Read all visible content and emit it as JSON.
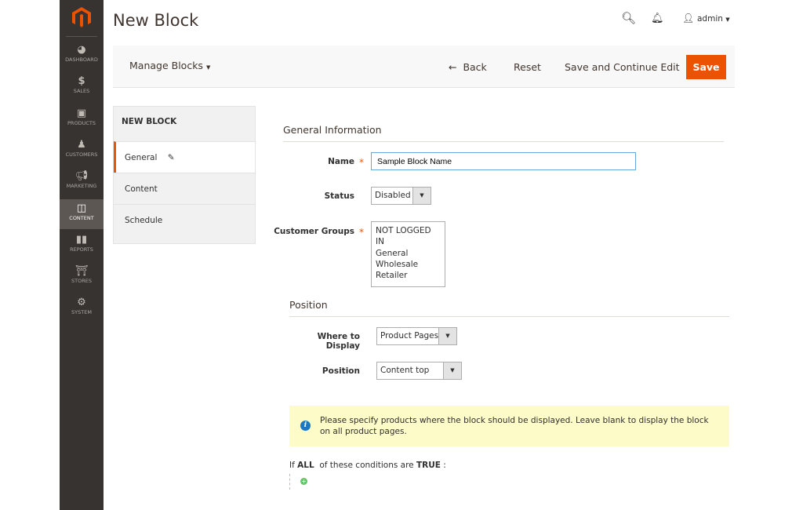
{
  "nav": {
    "items": [
      {
        "label": "DASHBOARD",
        "icon": "gauge-icon"
      },
      {
        "label": "SALES",
        "icon": "dollar-icon"
      },
      {
        "label": "PRODUCTS",
        "icon": "box-icon"
      },
      {
        "label": "CUSTOMERS",
        "icon": "person-icon"
      },
      {
        "label": "MARKETING",
        "icon": "megaphone-icon"
      },
      {
        "label": "CONTENT",
        "icon": "layout-icon",
        "active": true
      },
      {
        "label": "REPORTS",
        "icon": "bar-chart-icon"
      },
      {
        "label": "STORES",
        "icon": "storefront-icon"
      },
      {
        "label": "SYSTEM",
        "icon": "gear-icon"
      }
    ]
  },
  "header": {
    "title": "New Block",
    "user": "admin"
  },
  "actions": {
    "manage": "Manage Blocks",
    "back": "Back",
    "reset": "Reset",
    "save_continue": "Save and Continue Edit",
    "save": "Save"
  },
  "tabs": {
    "title": "NEW BLOCK",
    "items": [
      "General",
      "Content",
      "Schedule"
    ]
  },
  "general": {
    "title": "General Information",
    "name_label": "Name",
    "name_value": "Sample Block Name",
    "status_label": "Status",
    "status_value": "Disabled",
    "groups_label": "Customer Groups",
    "groups": [
      "NOT LOGGED IN",
      "General",
      "Wholesale",
      "Retailer"
    ]
  },
  "position": {
    "title": "Position",
    "where_label": "Where to Display",
    "where_value": "Product Pages",
    "position_label": "Position",
    "position_value": "Content top"
  },
  "notice": "Please specify products where the block should be displayed. Leave blank to display the block on all product pages.",
  "conditions": {
    "prefix": "If",
    "all": "ALL",
    "middle": "of these conditions are",
    "true": "TRUE",
    "suffix": ":"
  },
  "colors": {
    "accent": "#eb5202",
    "nav_bg": "#373330",
    "notice_bg": "#fdfbc8",
    "info": "#1979c3"
  }
}
